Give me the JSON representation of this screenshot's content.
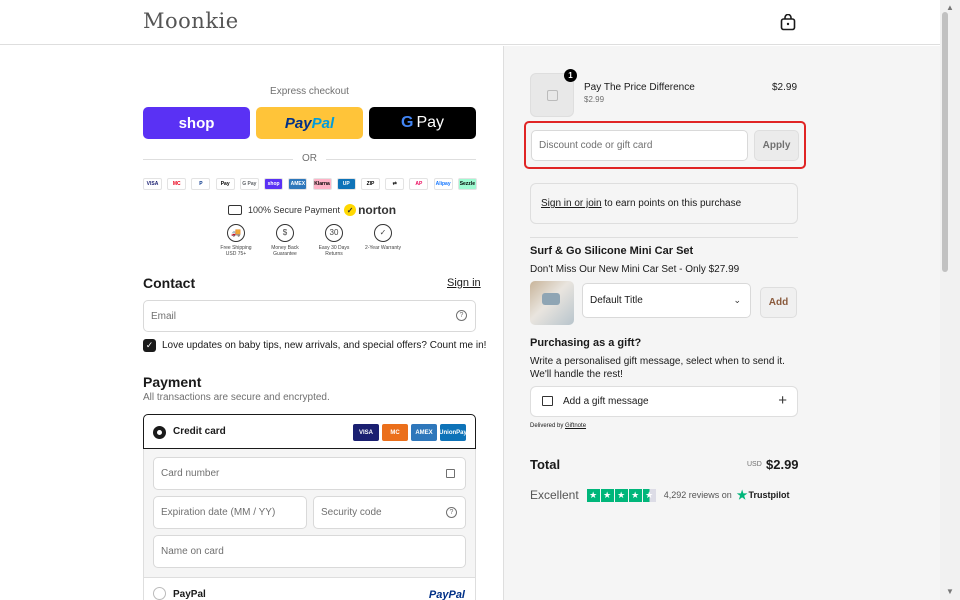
{
  "header": {
    "logo": "Moonkie",
    "cart_icon": "shopping-bag-icon"
  },
  "express": {
    "title": "Express checkout",
    "shop_label": "shop",
    "paypal_label_a": "Pay",
    "paypal_label_b": "Pal",
    "gpay_g": "G",
    "gpay_label": "Pay",
    "or_label": "OR"
  },
  "payment_icons": [
    {
      "label": "VISA",
      "color": "#ffffff",
      "text": "#1a1f71"
    },
    {
      "label": "MC",
      "color": "#ffffff",
      "text": "#eb001b"
    },
    {
      "label": "P",
      "color": "#ffffff",
      "text": "#003087"
    },
    {
      "label": "Pay",
      "color": "#ffffff",
      "text": "#000000"
    },
    {
      "label": "G Pay",
      "color": "#ffffff",
      "text": "#5f6368"
    },
    {
      "label": "shop",
      "color": "#5a31f4",
      "text": "#ffffff"
    },
    {
      "label": "AMEX",
      "color": "#2e77bb",
      "text": "#ffffff"
    },
    {
      "label": "Klarna",
      "color": "#ffb3c7",
      "text": "#000000"
    },
    {
      "label": "UP",
      "color": "#0e73b8",
      "text": "#ffffff"
    },
    {
      "label": "ZIP",
      "color": "#ffffff",
      "text": "#000000"
    },
    {
      "label": "⇄",
      "color": "#ffffff",
      "text": "#1a1a1a"
    },
    {
      "label": "AP",
      "color": "#ffffff",
      "text": "#eb0a5d"
    },
    {
      "label": "Alipay",
      "color": "#ffffff",
      "text": "#1677ff"
    },
    {
      "label": "Sezzle",
      "color": "#9efad1",
      "text": "#000000"
    }
  ],
  "trust": {
    "secure_text": "100% Secure Payment",
    "norton": "norton",
    "badges": [
      {
        "icon": "🚚",
        "text": "Free Shipping USD 75+"
      },
      {
        "icon": "$",
        "text": "Money Back Guarantee"
      },
      {
        "icon": "30",
        "text": "Easy 30 Days Returns"
      },
      {
        "icon": "✓",
        "text": "2-Year Warranty"
      }
    ]
  },
  "contact": {
    "title": "Contact",
    "sign_in": "Sign in",
    "email_placeholder": "Email",
    "newsletter_label": "Love updates on baby tips, new arrivals, and special offers? Count me in!"
  },
  "payment": {
    "title": "Payment",
    "subtitle": "All transactions are secure and encrypted.",
    "credit_card_label": "Credit card",
    "card_logos": [
      {
        "label": "VISA",
        "color": "#1a1f71"
      },
      {
        "label": "MC",
        "color": "#eb6f1b"
      },
      {
        "label": "AMEX",
        "color": "#2e77bb"
      },
      {
        "label": "UnionPay",
        "color": "#0e73b8"
      }
    ],
    "card_number_placeholder": "Card number",
    "expiry_placeholder": "Expiration date (MM / YY)",
    "security_placeholder": "Security code",
    "name_placeholder": "Name on card",
    "paypal_label": "PayPal",
    "paypal_logo": "PayPal"
  },
  "summary": {
    "item": {
      "name": "Pay The Price Difference",
      "variant": "$2.99",
      "price": "$2.99",
      "qty": "1"
    },
    "discount_placeholder": "Discount code or gift card",
    "apply_label": "Apply",
    "earn_link": "Sign in or join",
    "earn_text": " to earn points on this purchase",
    "upsell": {
      "title": "Surf & Go Silicone Mini Car Set",
      "subtitle": "Don't Miss Our New Mini Car Set - Only $27.99",
      "select_value": "Default Title",
      "add_label": "Add"
    },
    "gift": {
      "title": "Purchasing as a gift?",
      "description": "Write a personalised gift message, select when to send it. We'll handle the rest!",
      "button_label": "Add a gift message",
      "delivered_prefix": "Delivered by ",
      "delivered_brand": "Giftnote"
    },
    "total": {
      "label": "Total",
      "currency": "USD",
      "value": "$2.99"
    },
    "trustpilot": {
      "rating_word": "Excellent",
      "stars": 4.5,
      "reviews": "4,292 reviews on",
      "brand": "Trustpilot"
    }
  }
}
